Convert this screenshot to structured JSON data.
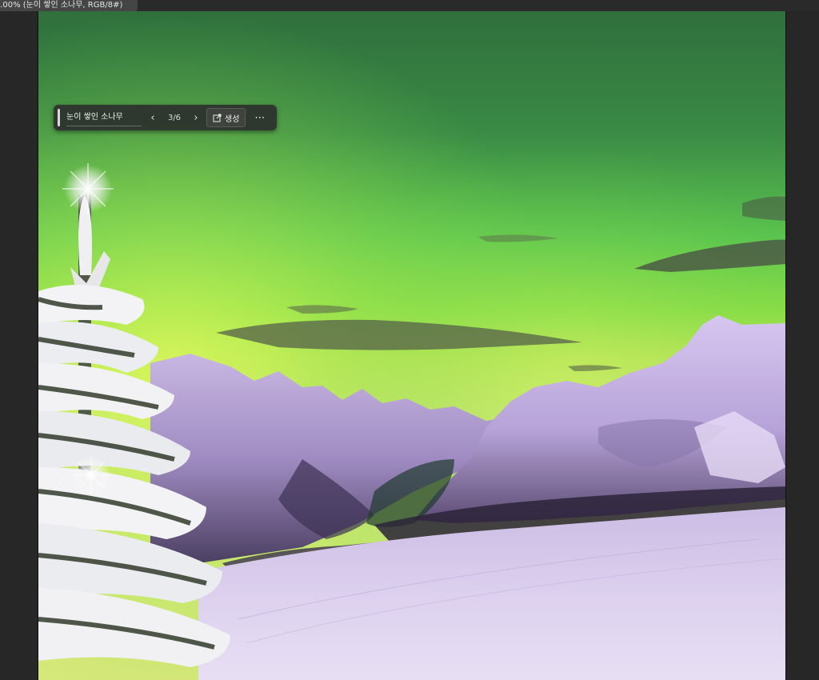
{
  "document_tab": {
    "title": "..00% (눈이 쌓인 소나무, RGB/8#)"
  },
  "contextual_bar": {
    "prompt": "눈이 쌓인 소나무",
    "variation_counter": "3/6",
    "generate_label": "생성",
    "icons": {
      "prev": "chevron-left-icon",
      "next": "chevron-right-icon",
      "generate": "generate-icon",
      "more": "more-options-icon"
    }
  },
  "colors": {
    "app_background": "#262626",
    "toolbar_background": "#2c302c",
    "aurora_green": "#5fd64a",
    "snow_lavender": "#d9cdeb"
  }
}
